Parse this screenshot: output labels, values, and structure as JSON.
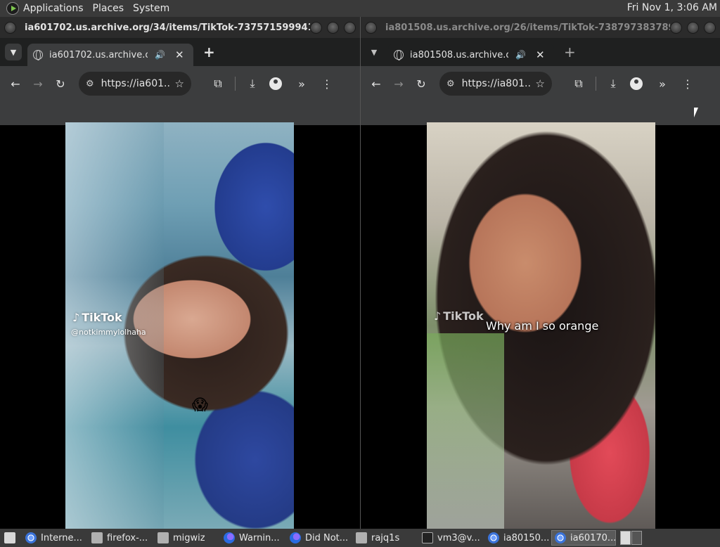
{
  "top_panel": {
    "menus": [
      "Applications",
      "Places",
      "System"
    ],
    "clock": "Fri Nov 1,  3:06 AM"
  },
  "left_window": {
    "title": "ia601702.us.archive.org/34/items/TikTok-737571599941430...",
    "tab_title": "ia601702.us.archive.org/3",
    "url": "https://ia601...",
    "video": {
      "tiktok_logo": "TikTok",
      "handle": "@notkimmylolhaha",
      "emoji": "😱"
    }
  },
  "right_window": {
    "title": "ia801508.us.archive.org/26/items/TikTok-738797383789324...",
    "tab_title": "ia801508.us.archive.org/",
    "url": "https://ia801...",
    "video": {
      "tiktok_logo": "TikTok",
      "caption": "Why am I so orange"
    }
  },
  "taskbar": {
    "items": [
      {
        "label": "Interne...",
        "icon": "chrome-icon"
      },
      {
        "label": "firefox-...",
        "icon": "file-icon"
      },
      {
        "label": "migwiz",
        "icon": "folder-icon"
      },
      {
        "label": "Warnin...",
        "icon": "firefox-icon"
      },
      {
        "label": "Did Not...",
        "icon": "firefox-icon"
      },
      {
        "label": "rajq1s",
        "icon": "file-icon"
      },
      {
        "label": "vm3@v...",
        "icon": "terminal-icon"
      },
      {
        "label": "ia80150...",
        "icon": "chrome-icon"
      },
      {
        "label": "ia60170...",
        "icon": "chrome-icon"
      }
    ]
  }
}
